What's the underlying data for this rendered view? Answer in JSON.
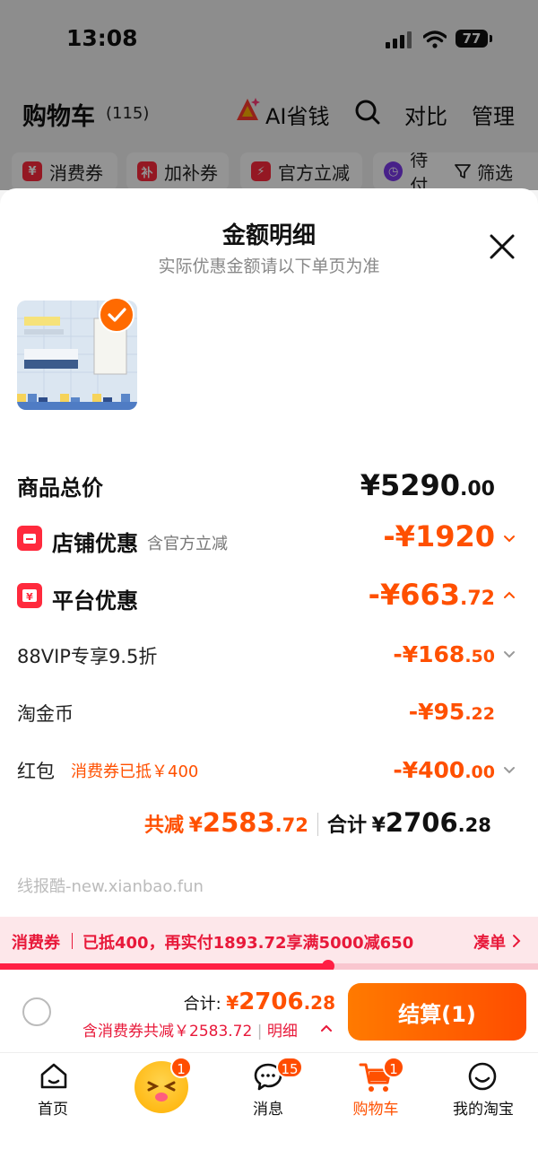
{
  "status": {
    "time": "13:08",
    "battery": "77"
  },
  "header": {
    "title": "购物车",
    "count": "(115)",
    "ai_label": "AI省钱",
    "compare": "对比",
    "manage": "管理"
  },
  "filters": [
    {
      "label": "消费券",
      "icon": "voucher-icon"
    },
    {
      "label": "加补券",
      "icon": "subsidy-icon"
    },
    {
      "label": "官方立减",
      "icon": "lightning-icon"
    },
    {
      "label": "待付",
      "icon": "clock-icon"
    },
    {
      "label": "筛选",
      "icon": "filter-icon"
    }
  ],
  "sheet": {
    "title": "金额明细",
    "subtitle": "实际优惠金额请以下单页为准",
    "total_label": "商品总价",
    "total": {
      "int": "¥5290",
      "dec": ".00"
    },
    "store_label": "店铺优惠",
    "store_note": "含官方立减",
    "store": {
      "int": "-¥1920",
      "dec": ""
    },
    "platform_label": "平台优惠",
    "platform": {
      "int": "-¥663",
      "dec": ".72"
    },
    "vip_label": "88VIP专享9.5折",
    "vip": {
      "int": "-¥168",
      "dec": ".50"
    },
    "coin_label": "淘金币",
    "coin": {
      "int": "-¥95",
      "dec": ".22"
    },
    "redpacket_label": "红包",
    "redpacket_note": "消费券已抵￥400",
    "redpacket": {
      "int": "-¥400",
      "dec": ".00"
    },
    "saved_label": "共减",
    "saved": {
      "sym": "¥",
      "int": "2583",
      "dec": ".72"
    },
    "sum_label": "合计",
    "sum": {
      "sym": "¥",
      "int": "2706",
      "dec": ".28"
    },
    "watermark": "线报酷-new.xianbao.fun"
  },
  "promo": {
    "tag": "消费券",
    "text": "已抵400，再实付1893.72享满5000减650",
    "action": "凑单",
    "progress": 0.61
  },
  "checkout": {
    "sum_label": "合计:",
    "sum_sym": "¥",
    "sum_int": "2706",
    "sum_dec": ".28",
    "detail": "含消费券共减￥2583.72",
    "detail_link": "明细",
    "button": "结算(1)"
  },
  "tabs": [
    {
      "label": "首页",
      "badge": ""
    },
    {
      "label": "",
      "badge": "1"
    },
    {
      "label": "消息",
      "badge": "15"
    },
    {
      "label": "购物车",
      "badge": "1"
    },
    {
      "label": "我的淘宝",
      "badge": ""
    }
  ],
  "colors": {
    "accent": "#ff5000",
    "red": "#ff2a3d",
    "promo_red": "#e8193a"
  }
}
